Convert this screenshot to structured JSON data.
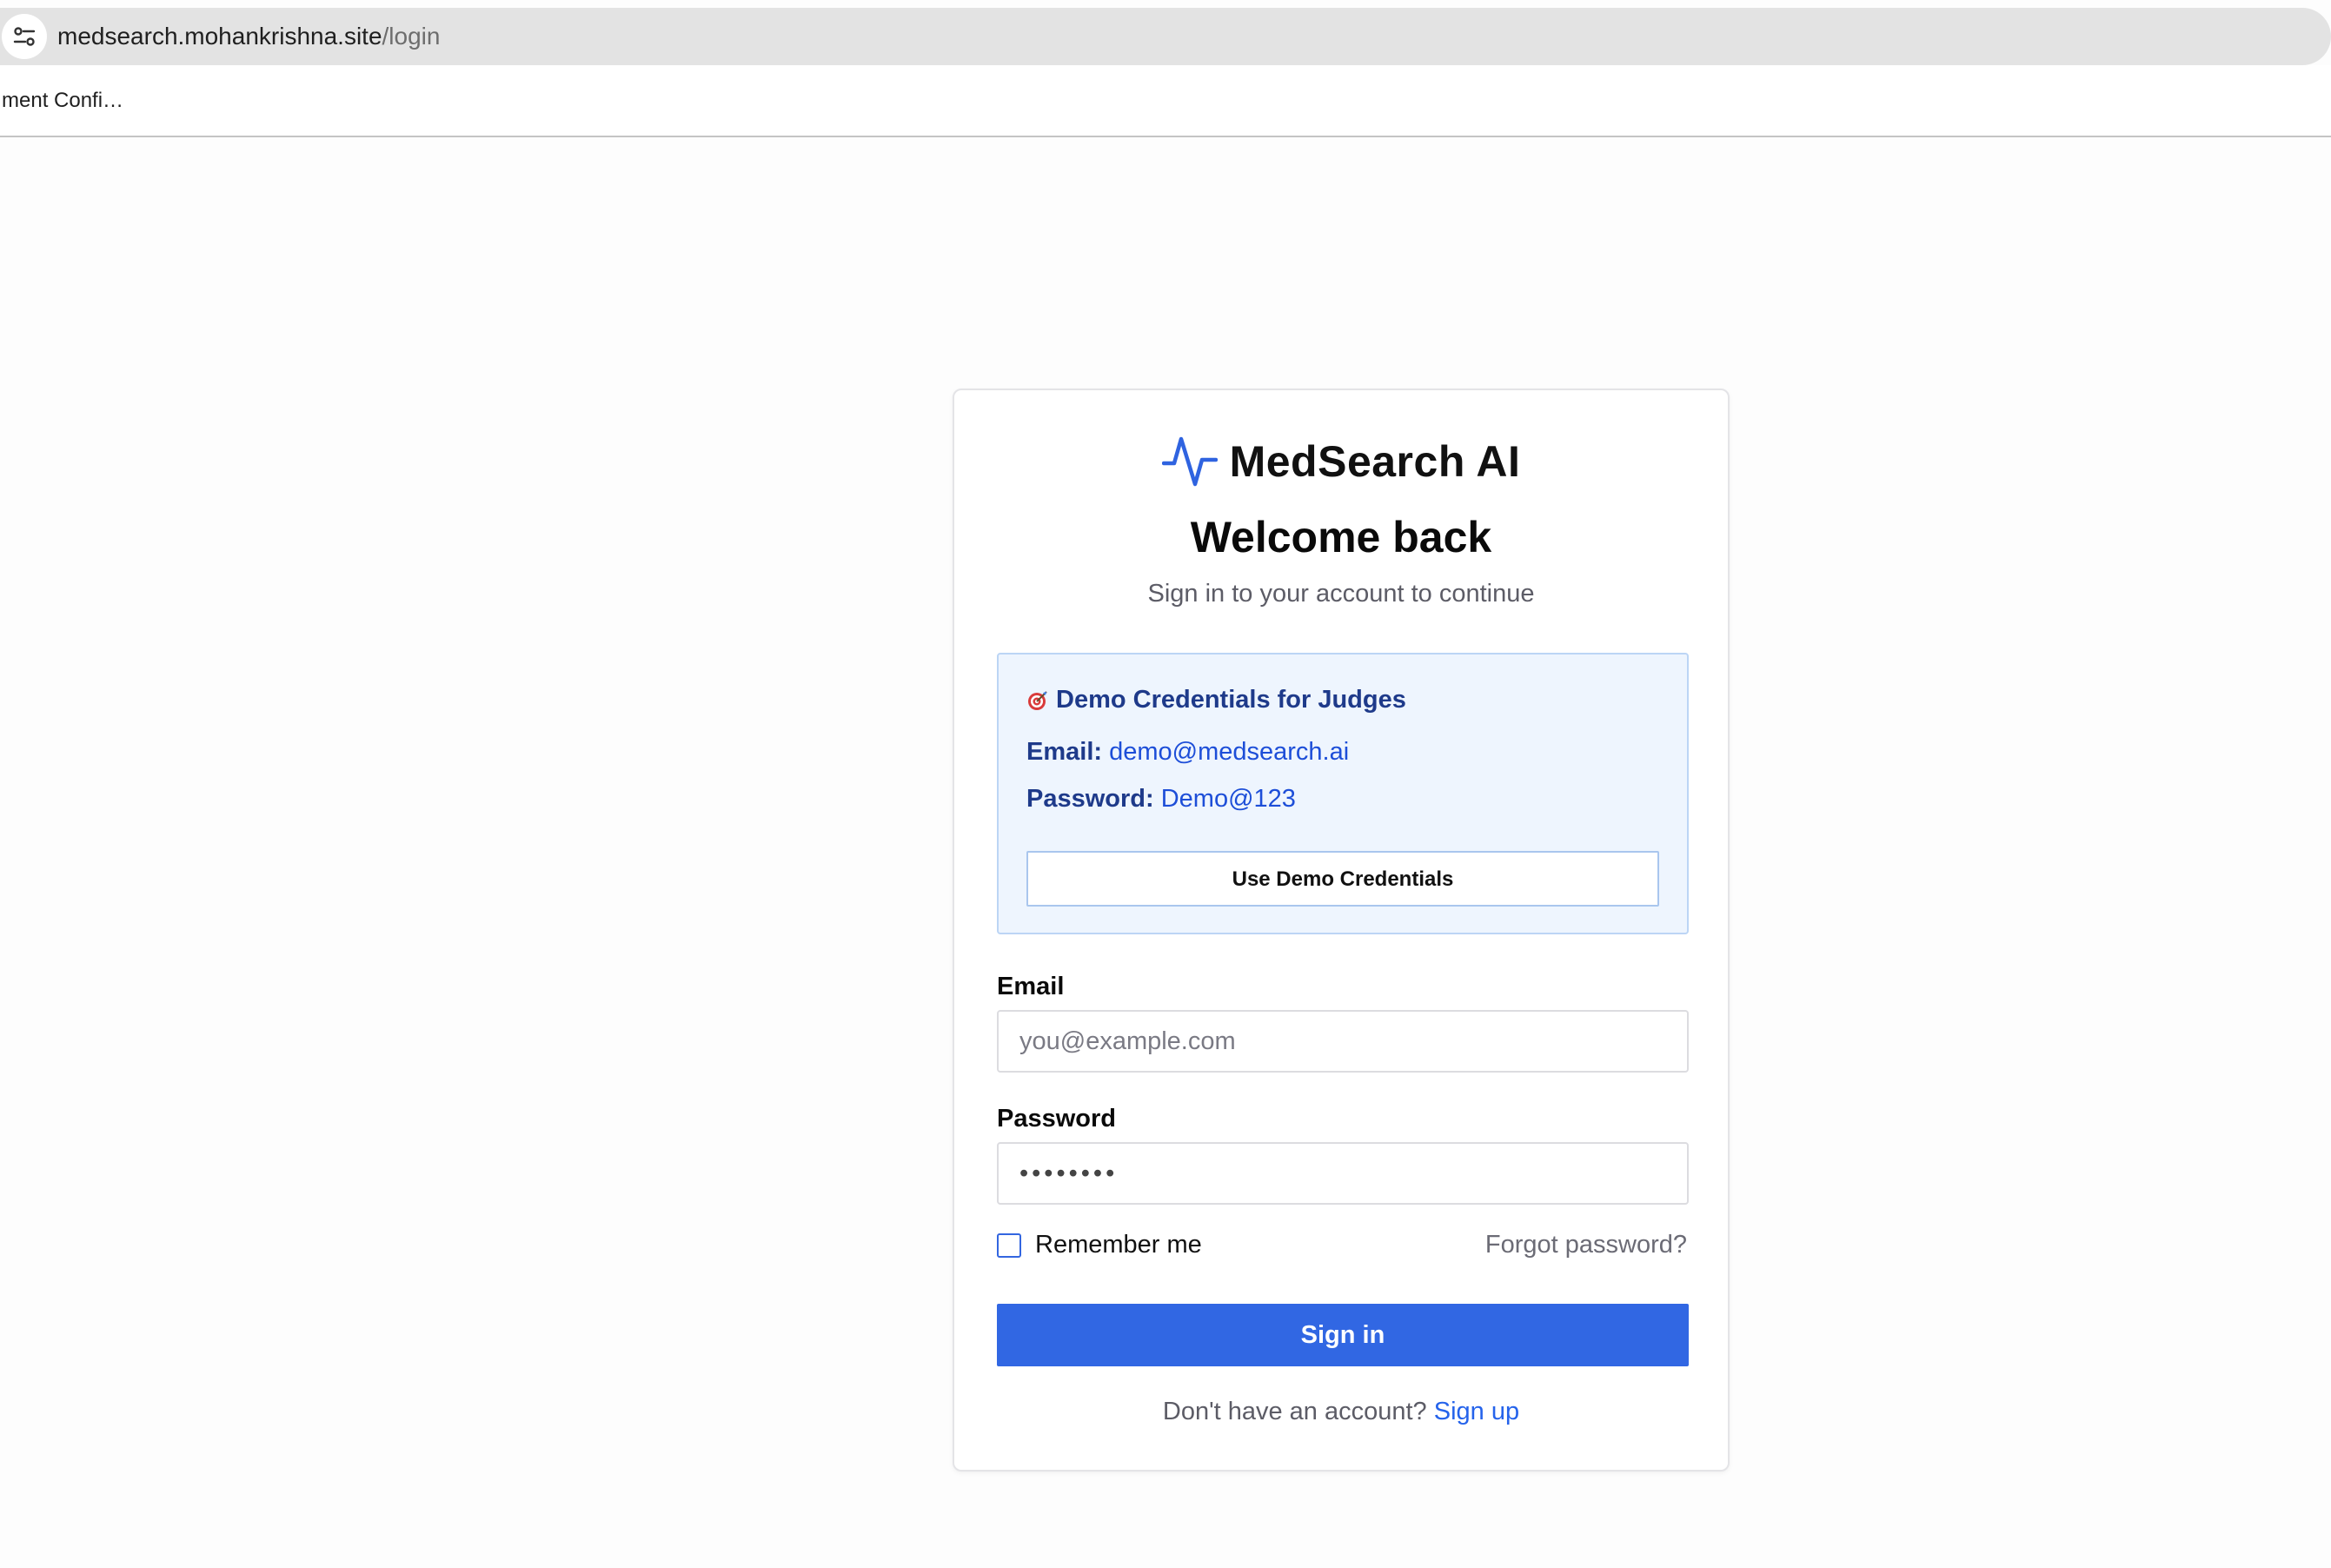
{
  "browser": {
    "url_host": "medsearch.mohankrishna.site",
    "url_path": "/login",
    "bookmark_label": "ment Confi…",
    "site_info_icon": "tune-icon"
  },
  "brand": {
    "logo_icon": "activity-pulse-icon",
    "name": "MedSearch AI",
    "accent_color": "#2f63e0"
  },
  "header": {
    "title": "Welcome back",
    "subtitle": "Sign in to your account to continue"
  },
  "demo": {
    "icon": "target-icon",
    "heading": "Demo Credentials for Judges",
    "email_label": "Email:",
    "email_value": "demo@medsearch.ai",
    "password_label": "Password:",
    "password_value": "Demo@123",
    "button_label": "Use Demo Credentials"
  },
  "form": {
    "email_label": "Email",
    "email_placeholder": "you@example.com",
    "email_value": "",
    "password_label": "Password",
    "password_value": "••••••••",
    "remember_label": "Remember me",
    "forgot_label": "Forgot password?",
    "submit_label": "Sign in",
    "submit_color": "#3167e3"
  },
  "footer": {
    "prompt": "Don't have an account?",
    "link_label": "Sign up"
  }
}
